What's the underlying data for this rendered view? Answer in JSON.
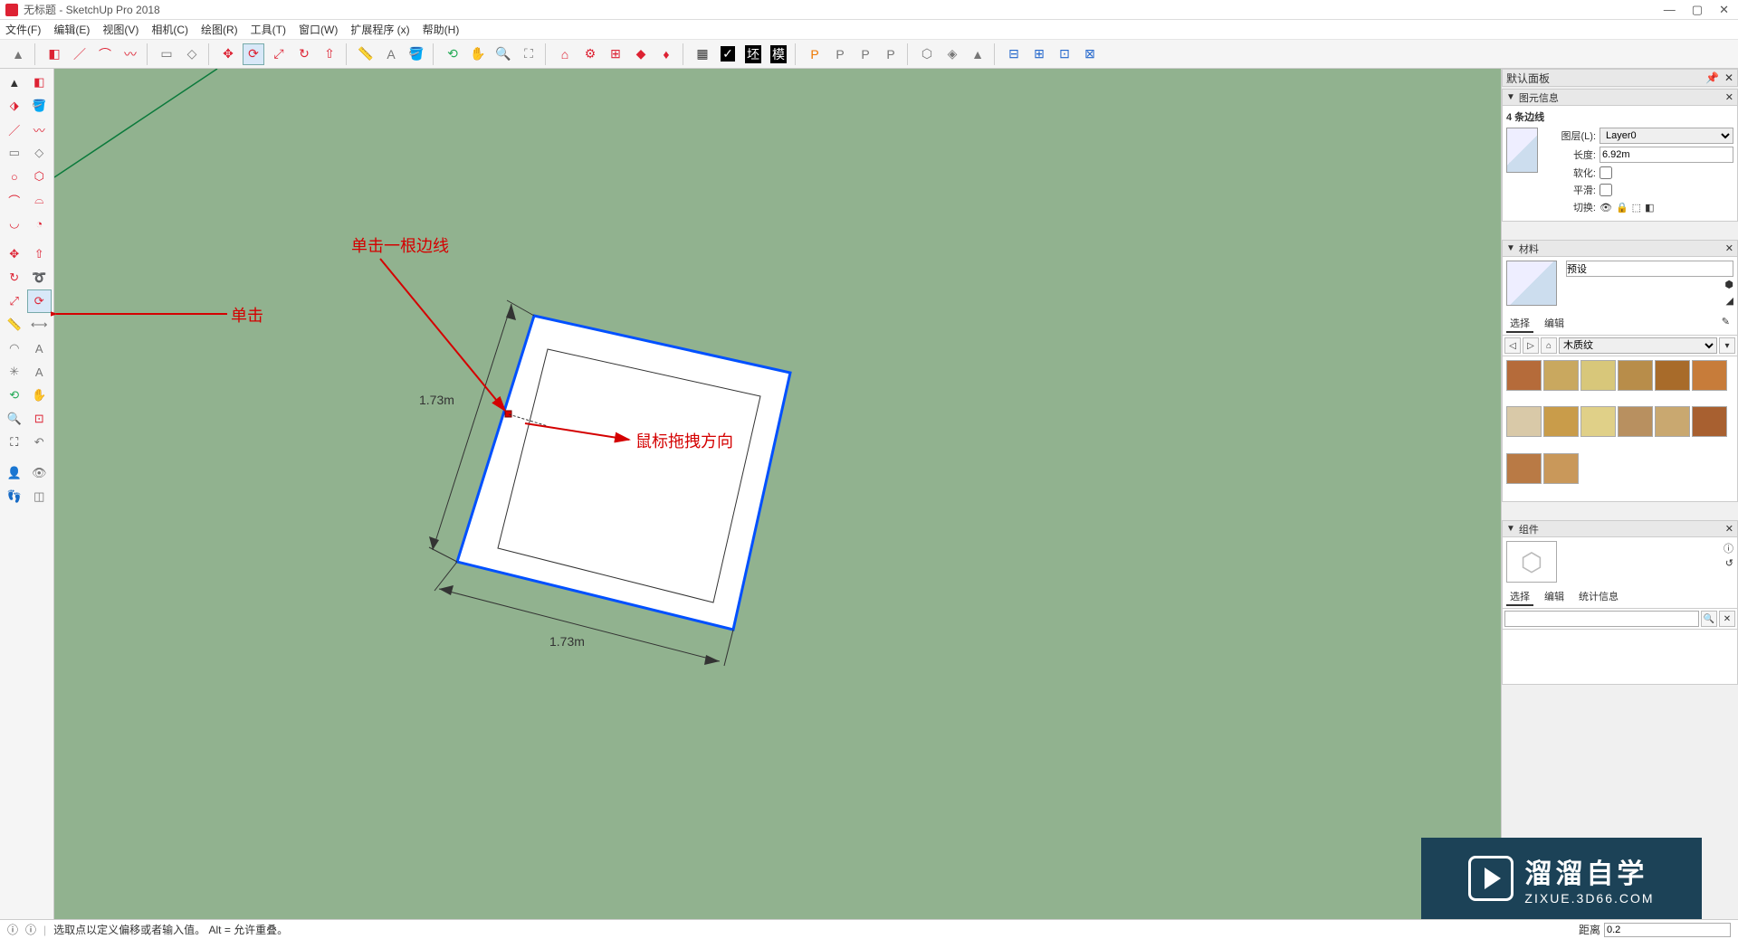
{
  "titlebar": {
    "title": "无标题 - SketchUp Pro 2018"
  },
  "menubar": [
    "文件(F)",
    "编辑(E)",
    "视图(V)",
    "相机(C)",
    "绘图(R)",
    "工具(T)",
    "窗口(W)",
    "扩展程序 (x)",
    "帮助(H)"
  ],
  "annotations": {
    "click_edge": "单击一根边线",
    "drag_dir": "鼠标拖拽方向",
    "click_tool": "单击"
  },
  "dims": {
    "a": "1.73m",
    "b": "1.73m"
  },
  "right": {
    "default_tray": "默认面板",
    "entity_info": {
      "title": "图元信息",
      "count": "4 条边线",
      "layer_label": "图层(L):",
      "layer_value": "Layer0",
      "length_label": "长度:",
      "length_value": "6.92m",
      "soften_label": "软化:",
      "smooth_label": "平滑:",
      "toggle_label": "切换:"
    },
    "materials": {
      "title": "材料",
      "preset": "预设",
      "tab_select": "选择",
      "tab_edit": "编辑",
      "category": "木质纹"
    },
    "components": {
      "title": "组件",
      "tab_select": "选择",
      "tab_edit": "编辑",
      "tab_stats": "统计信息"
    }
  },
  "statusbar": {
    "hint": "选取点以定义偏移或者输入值。  Alt = 允许重叠。",
    "dist_label": "距离",
    "dist_value": "0.2"
  },
  "watermark": {
    "line1": "溜溜自学",
    "line2": "ZIXUE.3D66.COM"
  },
  "mat_colors": [
    "#b56b3a",
    "#c9a85f",
    "#d8c77a",
    "#b88d4a",
    "#a86b2a",
    "#c77c3a",
    "#d9c9a8",
    "#c99c4a",
    "#e0d088",
    "#b89060",
    "#c9a870",
    "#a86030",
    "#b97a45",
    "#c9985a"
  ]
}
